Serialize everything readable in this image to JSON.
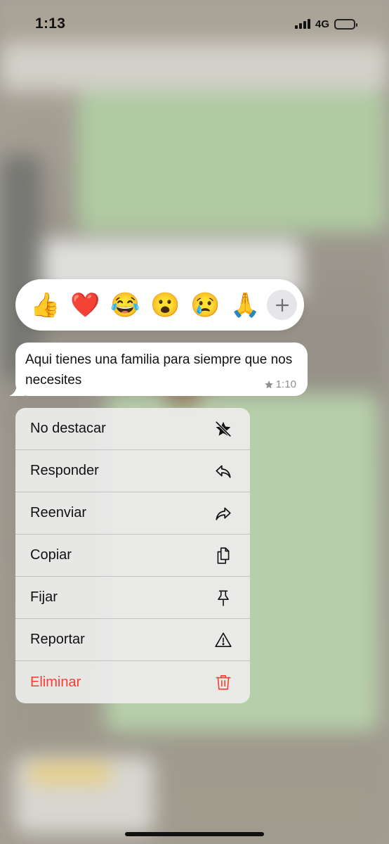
{
  "status_bar": {
    "time": "1:13",
    "network": "4G",
    "battery_level": 0.45
  },
  "reactions": {
    "emojis": [
      "👍",
      "❤️",
      "😂",
      "😮",
      "😢",
      "🙏"
    ],
    "more_icon": "plus-icon"
  },
  "message": {
    "text": "Aqui tienes una familia para siempre que nos necesites",
    "time": "1:10",
    "starred": true
  },
  "menu": {
    "items": [
      {
        "label": "No destacar",
        "icon": "unstar-icon",
        "destructive": false
      },
      {
        "label": "Responder",
        "icon": "reply-icon",
        "destructive": false
      },
      {
        "label": "Reenviar",
        "icon": "forward-icon",
        "destructive": false
      },
      {
        "label": "Copiar",
        "icon": "copy-icon",
        "destructive": false
      },
      {
        "label": "Fijar",
        "icon": "pin-icon",
        "destructive": false
      },
      {
        "label": "Reportar",
        "icon": "warning-icon",
        "destructive": false
      },
      {
        "label": "Eliminar",
        "icon": "trash-icon",
        "destructive": true
      }
    ]
  },
  "colors": {
    "destructive": "#ff3b30",
    "bubble": "#ffffff",
    "menu_background": "#ececec"
  }
}
